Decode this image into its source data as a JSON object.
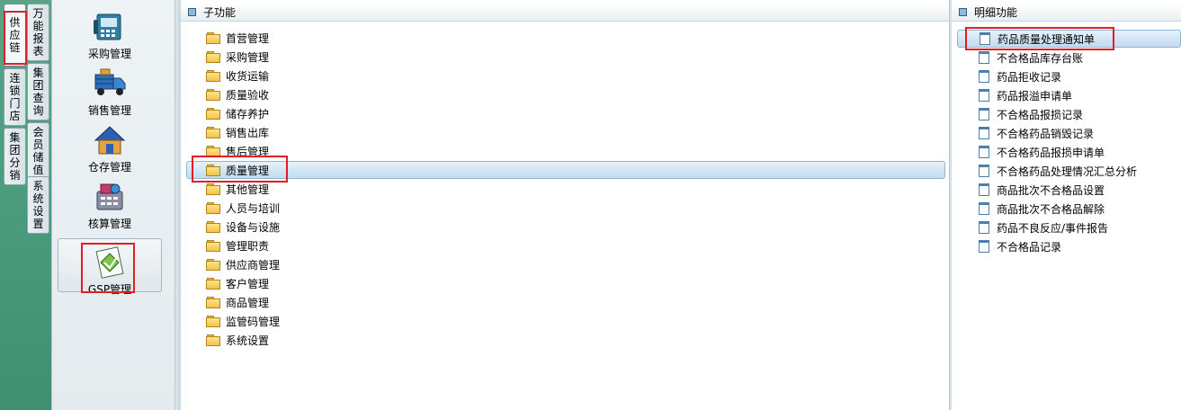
{
  "vertical_tabs": {
    "left": [
      {
        "label": "供应链",
        "chars": [
          "供",
          "应",
          "链"
        ],
        "active": true
      },
      {
        "label": "连锁门店",
        "chars": [
          "连",
          "锁",
          "门",
          "店"
        ],
        "active": false
      },
      {
        "label": "集团分销",
        "chars": [
          "集",
          "团",
          "分",
          "销"
        ],
        "active": false
      }
    ],
    "right": [
      {
        "label": "万能报表",
        "chars": [
          "万",
          "能",
          "报",
          "表"
        ]
      },
      {
        "label": "集团查询",
        "chars": [
          "集",
          "团",
          "查",
          "询"
        ]
      },
      {
        "label": "会员储值",
        "chars": [
          "会",
          "员",
          "储",
          "值"
        ]
      },
      {
        "label": "系统设置",
        "chars": [
          "系",
          "统",
          "设",
          "置"
        ]
      }
    ]
  },
  "nav": {
    "items": [
      {
        "label": "采购管理",
        "icon": "purchase-icon"
      },
      {
        "label": "销售管理",
        "icon": "sales-truck-icon"
      },
      {
        "label": "仓存管理",
        "icon": "warehouse-house-icon"
      },
      {
        "label": "核算管理",
        "icon": "accounting-icon"
      },
      {
        "label": "GSP管理",
        "icon": "gsp-icon",
        "selected": true
      }
    ]
  },
  "sub_panel": {
    "title": "子功能",
    "items": [
      {
        "label": "首营管理"
      },
      {
        "label": "采购管理"
      },
      {
        "label": "收货运输"
      },
      {
        "label": "质量验收"
      },
      {
        "label": "储存养护"
      },
      {
        "label": "销售出库"
      },
      {
        "label": "售后管理"
      },
      {
        "label": "质量管理",
        "selected": true
      },
      {
        "label": "其他管理"
      },
      {
        "label": "人员与培训"
      },
      {
        "label": "设备与设施"
      },
      {
        "label": "管理职责"
      },
      {
        "label": "供应商管理"
      },
      {
        "label": "客户管理"
      },
      {
        "label": "商品管理"
      },
      {
        "label": "监管码管理"
      },
      {
        "label": "系统设置"
      }
    ]
  },
  "detail_panel": {
    "title": "明细功能",
    "items": [
      {
        "label": "药品质量处理通知单",
        "selected": true
      },
      {
        "label": "不合格品库存台账"
      },
      {
        "label": "药品拒收记录"
      },
      {
        "label": "药品报溢申请单"
      },
      {
        "label": "不合格品报损记录"
      },
      {
        "label": "不合格药品销毁记录"
      },
      {
        "label": "不合格药品报损申请单"
      },
      {
        "label": "不合格药品处理情况汇总分析"
      },
      {
        "label": "商品批次不合格品设置"
      },
      {
        "label": "商品批次不合格品解除"
      },
      {
        "label": "药品不良反应/事件报告"
      },
      {
        "label": "不合格品记录"
      }
    ]
  },
  "colors": {
    "left_strip": "#4b9b7d",
    "highlight_border": "#e21e25",
    "selection": "#c2dcef"
  }
}
